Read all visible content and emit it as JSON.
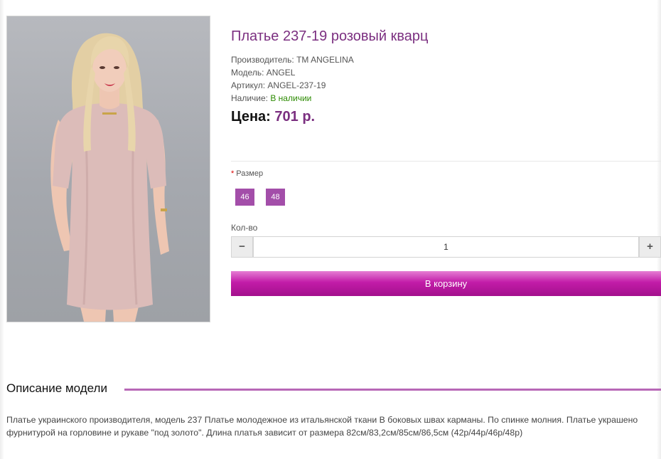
{
  "product": {
    "title": "Платье 237-19 розовый кварц",
    "manufacturer_label": "Производитель: ",
    "manufacturer_value": "TM ANGELINA",
    "model_label": "Модель: ",
    "model_value": "ANGEL",
    "sku_label": "Артикул: ",
    "sku_value": "ANGEL-237-19",
    "availability_label": "Наличие: ",
    "availability_value": "В наличии",
    "price_label": "Цена:",
    "price_value": "701 р."
  },
  "options": {
    "size_label": "Размер",
    "required_mark": "*",
    "sizes": [
      "46",
      "48"
    ]
  },
  "quantity": {
    "label": "Кол-во",
    "minus": "−",
    "plus": "+",
    "value": "1"
  },
  "cart_button": "В корзину",
  "description": {
    "heading": "Описание модели",
    "text": "Платье украинского производителя, модель 237 Платье молодежное из итальянской ткани В боковых швах карманы. По спинке молния. Платье украшено фурнитурой на горловине и рукаве \"под золото\". Длина платья зависит от размера 82см/83,2см/85см/86,5см (42р/44р/46р/48р)"
  },
  "colors": {
    "accent": "#7b2f80",
    "size_button": "#a34ea9",
    "cart_button": "#c21ca8",
    "in_stock": "#2b8a00"
  }
}
